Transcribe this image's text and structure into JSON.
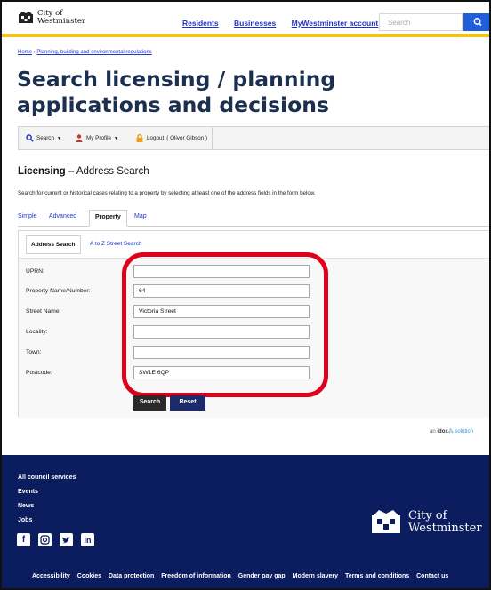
{
  "header": {
    "logo_line1": "City of",
    "logo_line2": "Westminster",
    "nav": [
      "Residents",
      "Businesses",
      "MyWestminster account"
    ],
    "search_placeholder": "Search",
    "accent_color": "#f1c40f"
  },
  "breadcrumb": {
    "home": "Home",
    "separator": "›",
    "section": "Planning, building and environmental regulations"
  },
  "page_title": "Search licensing / planning applications and decisions",
  "toolbar": {
    "search_label": "Search",
    "profile_label": "My Profile",
    "logout_label": "Logout",
    "user": "( Oliver Gibson )"
  },
  "section": {
    "title_bold": "Licensing",
    "title_rest": " – Address Search",
    "intro": "Search for current or historical cases relating to a property by selecting at least one of the address fields in the form below."
  },
  "tabs": [
    "Simple",
    "Advanced",
    "Property",
    "Map"
  ],
  "active_tab": "Property",
  "subtabs": [
    "Address Search",
    "A to Z Street Search"
  ],
  "form": {
    "fields": [
      {
        "label": "UPRN:",
        "value": ""
      },
      {
        "label": "Property Name/Number:",
        "value": "64"
      },
      {
        "label": "Street Name:",
        "value": "Victoria Street"
      },
      {
        "label": "Locality:",
        "value": ""
      },
      {
        "label": "Town:",
        "value": ""
      },
      {
        "label": "Postcode:",
        "value": "SW1E 6QP"
      }
    ],
    "search_button": "Search",
    "reset_button": "Reset"
  },
  "idox": {
    "prefix": "an",
    "brand": "idox",
    "suffix": "solution"
  },
  "footer": {
    "links": [
      "All council services",
      "Events",
      "News",
      "Jobs"
    ],
    "social_icons": [
      "facebook-icon",
      "instagram-icon",
      "twitter-icon",
      "linkedin-icon"
    ],
    "logo_line1": "City of",
    "logo_line2": "Westminster",
    "bottom_links": [
      "Accessibility",
      "Cookies",
      "Data protection",
      "Freedom of information",
      "Gender pay gap",
      "Modern slavery",
      "Terms and conditions",
      "Contact us"
    ],
    "bg_color": "#0b1d5e"
  }
}
